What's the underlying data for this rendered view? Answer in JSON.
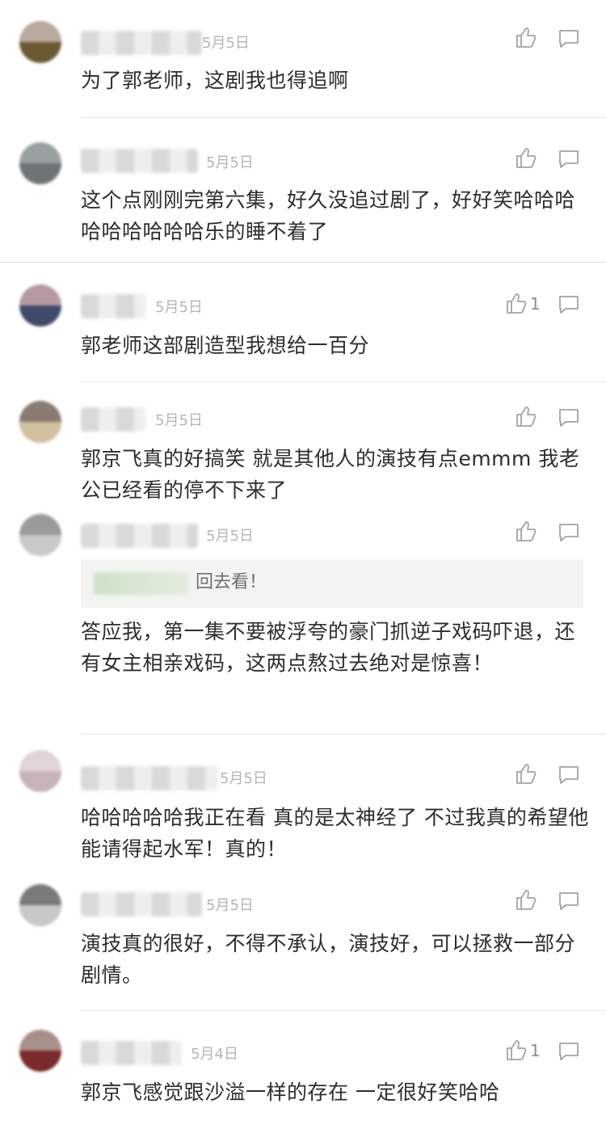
{
  "comments": [
    {
      "date": "5月5日",
      "likes": "",
      "text": "为了郭老师，这剧我也得追啊",
      "avatar": [
        "#b9a9a0",
        "#6a5a32"
      ]
    },
    {
      "date": "5月5日",
      "likes": "",
      "text": "这个点刚刚完第六集，好久没追过剧了，好好笑哈哈哈哈哈哈哈哈哈乐的睡不着了",
      "avatar": [
        "#9aa0a0",
        "#6e7474"
      ]
    },
    {
      "date": "5月5日",
      "likes": "1",
      "text": "郭老师这部剧造型我想给一百分",
      "avatar": [
        "#b59aa0",
        "#3f4a6a"
      ]
    },
    {
      "date": "5月5日",
      "likes": "",
      "text": "郭京飞真的好搞笑 就是其他人的演技有点emmm 我老公已经看的停不下来了",
      "avatar": [
        "#8a7a70",
        "#d2bfa0"
      ]
    },
    {
      "date": "5月5日",
      "likes": "",
      "quote": "回去看！",
      "text": "答应我，第一集不要被浮夸的豪门抓逆子戏码吓退，还有女主相亲戏码，这两点熬过去绝对是惊喜！",
      "avatar": [
        "#9a9a9a",
        "#c9c9c9"
      ]
    },
    {
      "date": "5月5日",
      "likes": "",
      "text": "哈哈哈哈哈我正在看 真的是太神经了 不过我真的希望他能请得起水军！真的！",
      "avatar": [
        "#e0d4d8",
        "#c9b3bb"
      ]
    },
    {
      "date": "5月5日",
      "likes": "",
      "text": "演技真的很好，不得不承认，演技好，可以拯救一部分剧情。",
      "avatar": [
        "#7a7a7a",
        "#c8c8c8"
      ]
    },
    {
      "date": "5月4日",
      "likes": "1",
      "text": "郭京飞感觉跟沙溢一样的存在 一定很好笑哈哈",
      "avatar": [
        "#a8908a",
        "#7a2a2a"
      ]
    }
  ]
}
